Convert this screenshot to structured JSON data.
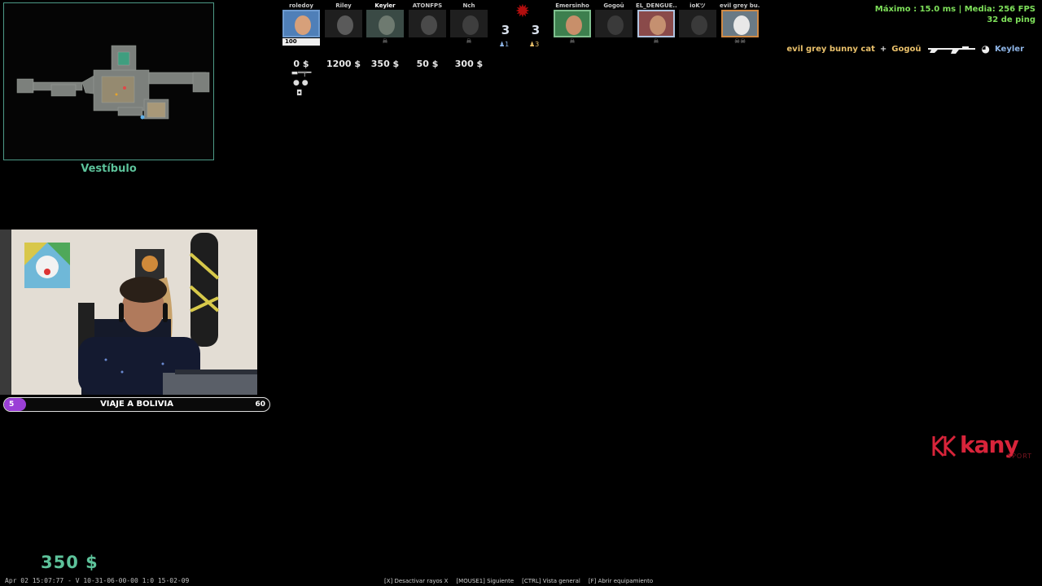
{
  "minimap": {
    "location": "Vestíbulo"
  },
  "scoreboard": {
    "ct_players": [
      {
        "name": "roledoy",
        "money": "0 $",
        "hp": "100",
        "state": "alive"
      },
      {
        "name": "Riley",
        "money": "1200 $",
        "state": "dead"
      },
      {
        "name": "Keyler",
        "money": "350 $",
        "state": "dead",
        "active": true
      },
      {
        "name": "ATONFPS",
        "money": "50 $",
        "state": "dead"
      },
      {
        "name": "Nch",
        "money": "300 $",
        "state": "dead"
      }
    ],
    "t_players": [
      {
        "name": "Emersinho",
        "state": "alive"
      },
      {
        "name": "Gogoū",
        "state": "dead"
      },
      {
        "name": "EL_DENGUE..",
        "state": "alive"
      },
      {
        "name": "ioKツ",
        "state": "dead"
      },
      {
        "name": "evil grey bu..",
        "state": "alive"
      }
    ],
    "ct_score": "3",
    "t_score": "3",
    "ct_alive": "1",
    "t_alive": "3"
  },
  "netgraph": {
    "line1": "Máximo :  15.0 ms | Media:  256 FPS",
    "line2": "32 de ping"
  },
  "killfeed": {
    "attacker": "evil grey bunny cat",
    "plus": "+",
    "assister": "Gogoū",
    "victim": "Keyler",
    "weapon_icon": "rifle-icon",
    "headshot_icon": "headshot-icon"
  },
  "goal": {
    "min": "5",
    "title": "VIAJE A BOLIVIA",
    "max": "60",
    "progress_fraction": 0.083
  },
  "sponsor": {
    "name": "kany",
    "sub": "SPORT"
  },
  "player_money": "350  $",
  "bottom": {
    "debug_text": "Apr 02 15:07:77 - V 10-31-06-00-00 1:0 15-02-09",
    "hints": [
      "[X] Desactivar rayos X",
      "[MOUSE1] Siguiente",
      "[CTRL] Vista general",
      "[F] Abrir equipamiento"
    ]
  },
  "colors": {
    "accent_green": "#5cc29a",
    "active_column": "#2fae85",
    "ct_blue": "#8fb6e8",
    "t_gold": "#eac16b",
    "netgraph_green": "#7ee05a",
    "goal_fill": "#9a3fd6",
    "sponsor_red": "#d8243a"
  }
}
